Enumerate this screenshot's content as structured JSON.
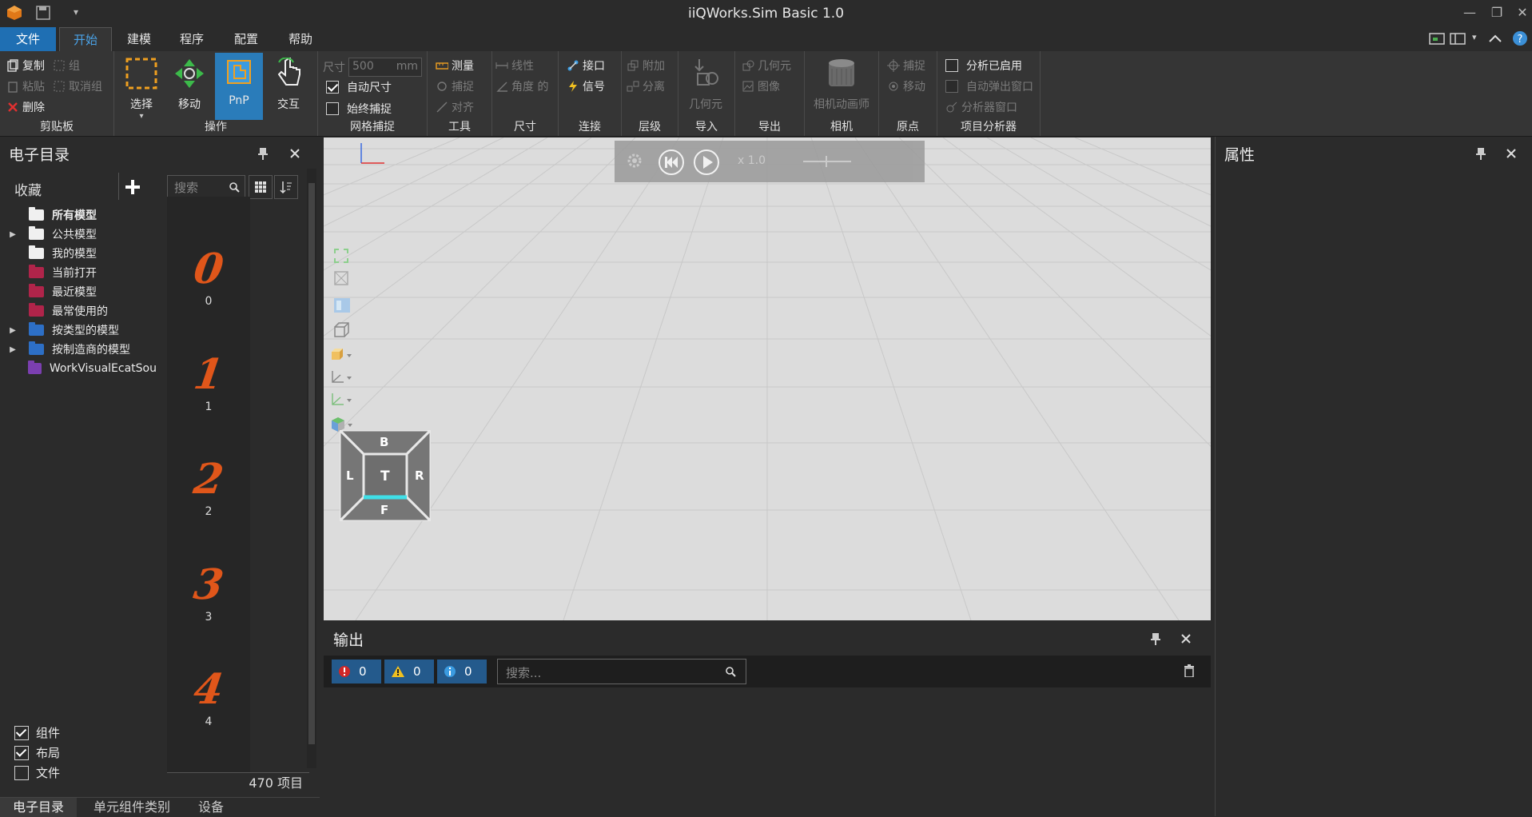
{
  "window": {
    "title": "iiQWorks.Sim Basic 1.0"
  },
  "menu_tabs": [
    "文件",
    "开始",
    "建模",
    "程序",
    "配置",
    "帮助"
  ],
  "ribbon": {
    "clipboard": {
      "label": "剪贴板",
      "copy": "复制",
      "group": "组",
      "paste": "粘贴",
      "ungroup": "取消组",
      "delete": "删除"
    },
    "operate": {
      "label": "操作",
      "select": "选择",
      "move": "移动",
      "pnp": "PnP",
      "interact": "交互"
    },
    "grid_snap": {
      "label": "网格捕捉",
      "size_label": "尺寸",
      "size_value": "500",
      "size_unit": "mm",
      "auto_size": "自动尺寸",
      "always_snap": "始终捕捉"
    },
    "tools": {
      "label": "工具",
      "measure": "测量",
      "snap": "捕捉",
      "align": "对齐"
    },
    "dimension": {
      "label": "尺寸",
      "linear": "线性",
      "angle": "角度 的"
    },
    "connect": {
      "label": "连接",
      "interface": "接口",
      "signal": "信号"
    },
    "hierarchy": {
      "label": "层级",
      "attach": "附加",
      "detach": "分离"
    },
    "import": {
      "label": "导入",
      "geometry": "几何元"
    },
    "export": {
      "label": "导出",
      "geometry": "几何元",
      "image": "图像"
    },
    "camera": {
      "label": "相机",
      "animator": "相机动画师"
    },
    "origin": {
      "label": "原点",
      "snap": "捕捉",
      "move": "移动"
    },
    "analyzer": {
      "label": "项目分析器",
      "enabled": "分析已启用",
      "auto_popup": "自动弹出窗口",
      "window": "分析器窗口"
    }
  },
  "catalog": {
    "title": "电子目录",
    "favorites": "收藏",
    "search_placeholder": "搜索",
    "tree": [
      "所有模型",
      "公共模型",
      "我的模型",
      "当前打开",
      "最近模型",
      "最常使用的",
      "按类型的模型",
      "按制造商的模型",
      "WorkVisualEcatSou"
    ],
    "side_tab": "收藏",
    "items": [
      {
        "glyph": "0",
        "caption": "0"
      },
      {
        "glyph": "1",
        "caption": "1"
      },
      {
        "glyph": "2",
        "caption": "2"
      },
      {
        "glyph": "3",
        "caption": "3"
      },
      {
        "glyph": "4",
        "caption": "4"
      }
    ],
    "count": "470 项目",
    "filters": [
      {
        "label": "组件",
        "checked": true
      },
      {
        "label": "布局",
        "checked": true
      },
      {
        "label": "文件",
        "checked": false
      }
    ],
    "bottom_tabs": [
      "电子目录",
      "单元组件类别",
      "设备"
    ]
  },
  "viewport": {
    "speed": "x 1.0",
    "cube": {
      "top": "B",
      "left": "L",
      "center": "T",
      "right": "R",
      "bottom": "F"
    }
  },
  "properties": {
    "title": "属性"
  },
  "output": {
    "title": "输出",
    "errors": "0",
    "warnings": "0",
    "infos": "0",
    "search_placeholder": "搜索..."
  },
  "colors": {
    "accent": "#1f6fb3",
    "orange": "#e0561a",
    "viewport_bg": "#dcdcdc"
  }
}
